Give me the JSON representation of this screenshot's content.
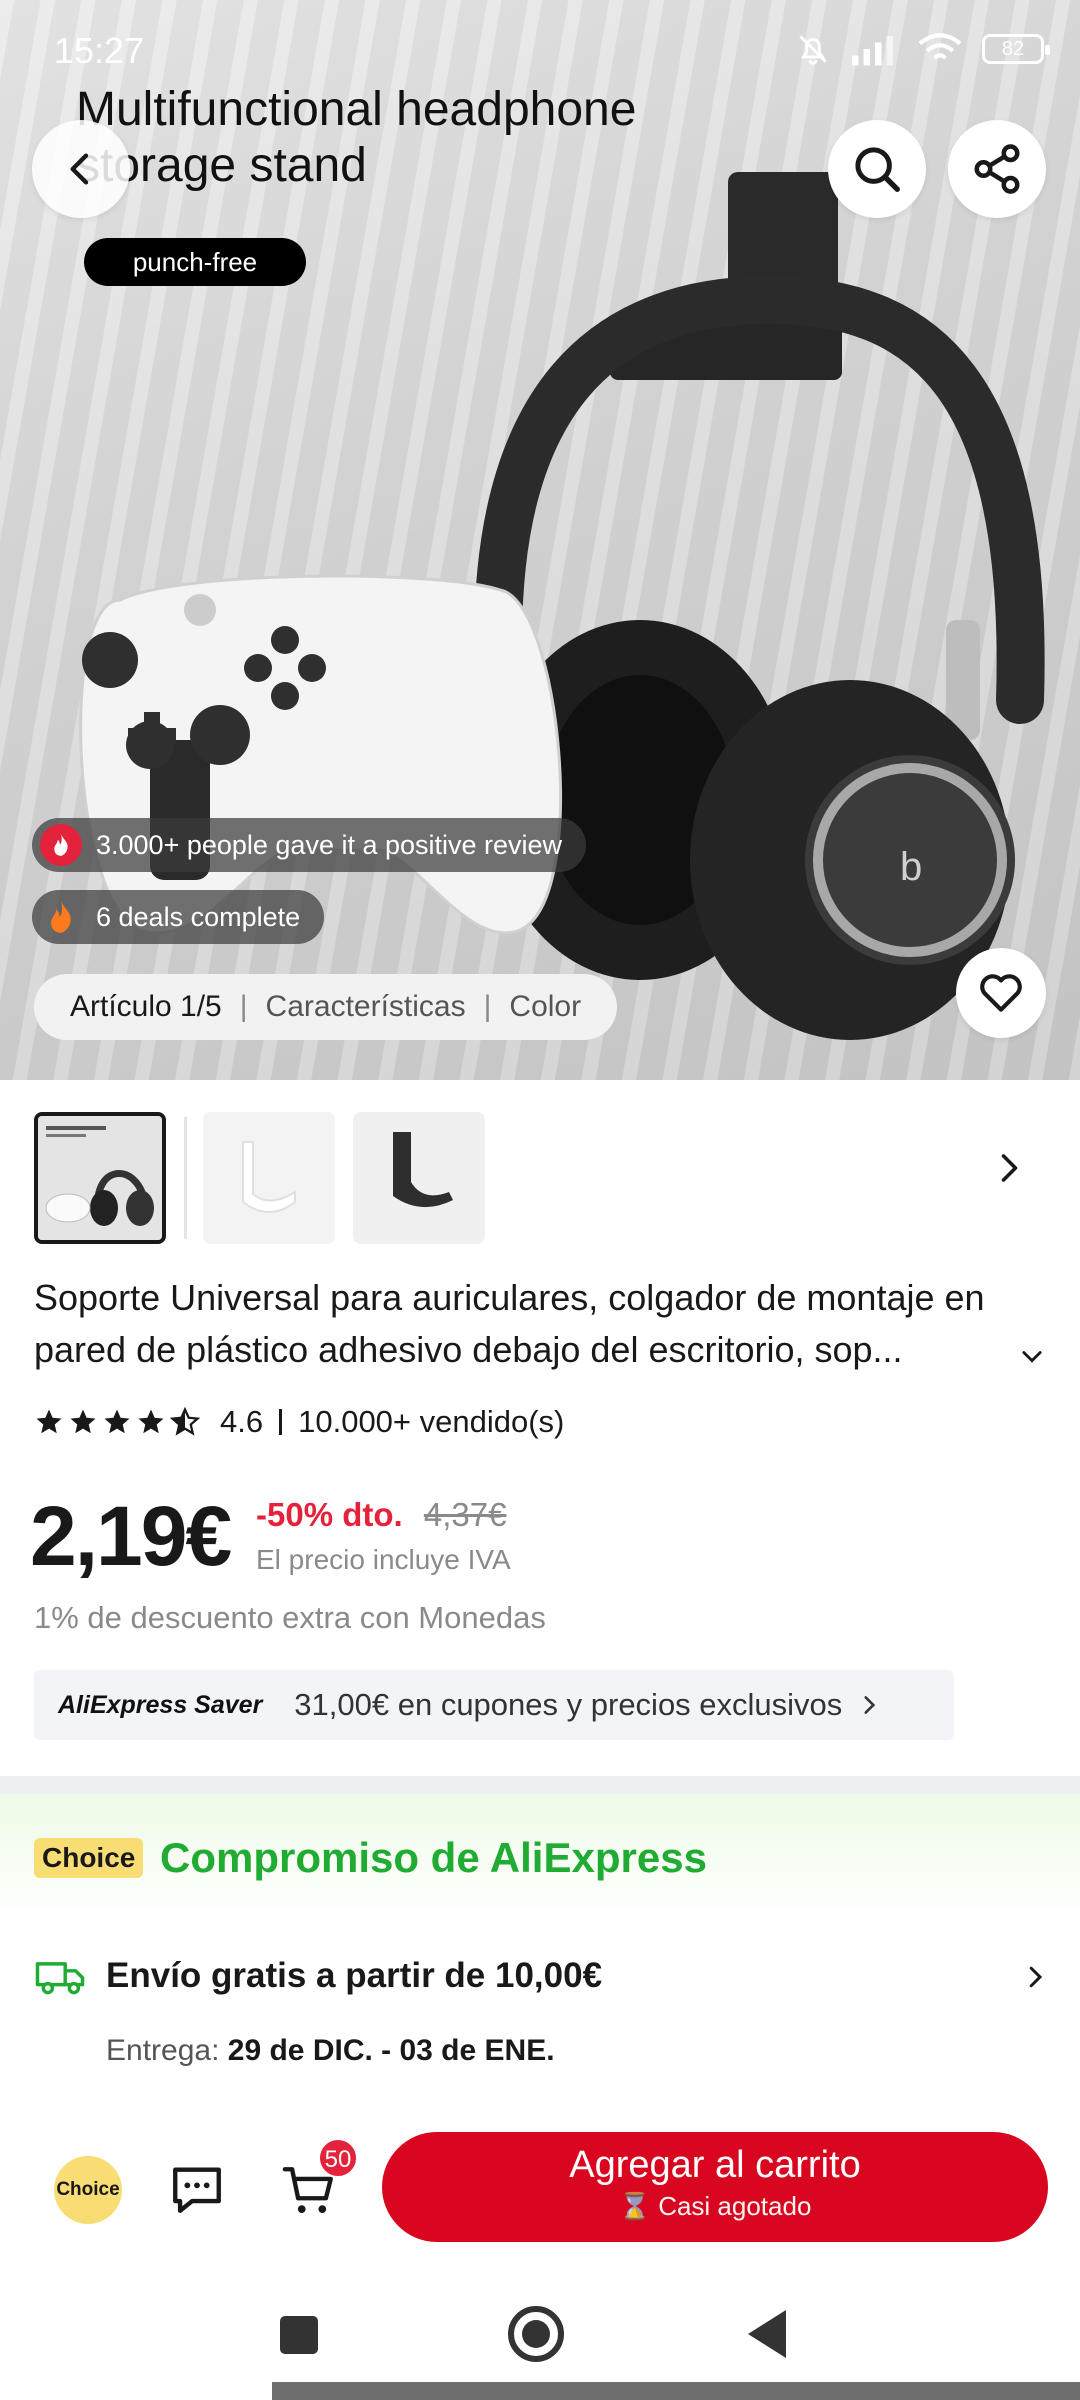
{
  "status_bar": {
    "time": "15:27",
    "battery": "82"
  },
  "hero": {
    "title_line1": "Multifunctional headphone",
    "title_line2": "storage stand",
    "tag": "punch-free",
    "review_pill": "3.000+ people gave it a positive review",
    "deals_pill": "6 deals complete",
    "tabs": [
      "Artículo 1/5",
      "Características",
      "Color"
    ]
  },
  "product": {
    "title": "Soporte Universal para auriculares, colgador de montaje en pared de plástico adhesivo debajo del escritorio, sop...",
    "rating": "4.6",
    "sold": "10.000+ vendido(s)",
    "rating_value": 4.6
  },
  "pricing": {
    "price": "2,19€",
    "discount": "-50% dto.",
    "old_price": "4,37€",
    "vat_note": "El precio incluye IVA",
    "coins_note": "1% de descuento extra con Monedas"
  },
  "saver": {
    "brand": "AliExpress Saver",
    "text": "31,00€ en cupones y precios exclusivos"
  },
  "choice": {
    "badge": "Choice",
    "title": "Compromiso de AliExpress",
    "shipping": "Envío gratis a partir de 10,00€",
    "delivery_label": "Entrega:",
    "delivery_dates": "29 de DIC. - 03 de ENE."
  },
  "actions": {
    "choice_label": "Choice",
    "cart_count": "50",
    "add_to_cart": "Agregar al carrito",
    "stock_note": "Casi agotado"
  },
  "colors": {
    "accent_red": "#d9061f",
    "choice_green": "#20ab32",
    "choice_yellow": "#f8dd74"
  }
}
